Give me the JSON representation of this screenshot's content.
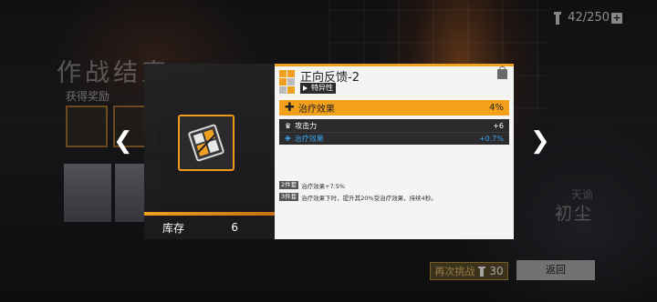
{
  "stamina": {
    "value": "42/250",
    "plus_label": "+"
  },
  "background": {
    "battle_result_title": "作战结束",
    "reward_label": "获得奖励",
    "faded_name_small": "",
    "faded_name_mid": "天谕",
    "faded_name_big": "初尘"
  },
  "buttons": {
    "retry_label": "再次挑战",
    "retry_cost": "30",
    "back_label": "返回"
  },
  "item": {
    "stock_label": "库存",
    "stock_value": "6"
  },
  "detail": {
    "name": "正向反馈-2",
    "trait": "特异性",
    "main_effect": {
      "label": "治疗效果",
      "value": "4%"
    },
    "sub_stats": [
      {
        "label": "攻击力",
        "value": "+6",
        "icon": "crown-icon"
      },
      {
        "label": "治疗效果",
        "value": "+0.7%",
        "icon": "plus-icon"
      }
    ],
    "set_bonuses": [
      {
        "tag": "2件套",
        "text": "治疗效果+7.5%"
      },
      {
        "tag": "3件套",
        "text": "治疗效果下时，提升其20%受治疗效果，持续4秒。"
      }
    ]
  },
  "nav": {
    "prev": "❮",
    "next": "❯"
  },
  "colors": {
    "accent": "#f3a01b",
    "substat_blue": "#3aa4f0",
    "panel_light": "#f4f4f4",
    "panel_dark": "#222224"
  }
}
